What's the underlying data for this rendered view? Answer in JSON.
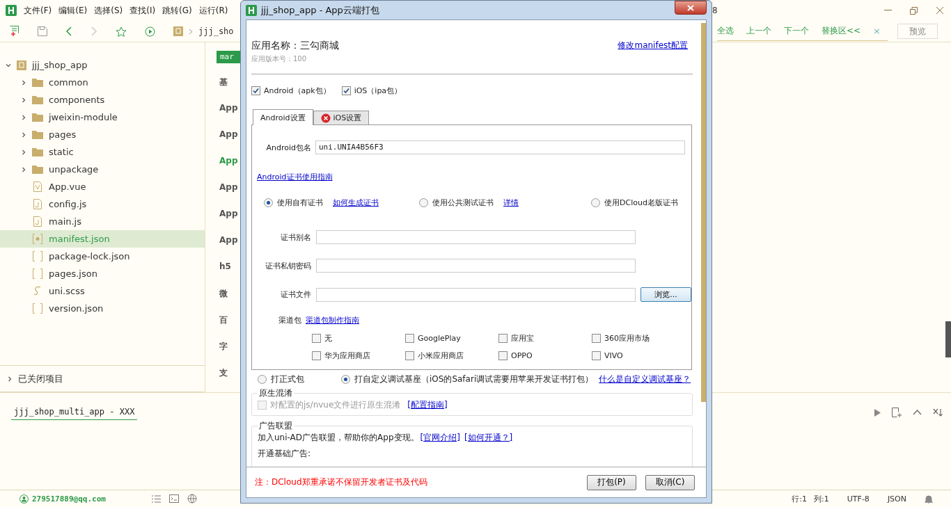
{
  "menu_bar": {
    "items": [
      "文件(F)",
      "编辑(E)",
      "选择(S)",
      "查找(I)",
      "跳转(G)",
      "运行(R)"
    ],
    "title_fragment": "8"
  },
  "toolbar": {
    "breadcrumb": "jjj_sho",
    "find_actions": [
      "全选",
      "上一个",
      "下一个",
      "替换区<<"
    ],
    "find_close": "×",
    "preview": "预览"
  },
  "sidebar": {
    "project": {
      "name": "jjj_shop_app",
      "expanded": true,
      "children": [
        {
          "name": "common",
          "kind": "folder",
          "expanded": false,
          "selected": false
        },
        {
          "name": "components",
          "kind": "folder",
          "expanded": false,
          "selected": false
        },
        {
          "name": "jweixin-module",
          "kind": "folder",
          "expanded": false,
          "selected": false
        },
        {
          "name": "pages",
          "kind": "folder",
          "expanded": false,
          "selected": false
        },
        {
          "name": "static",
          "kind": "folder",
          "expanded": false,
          "selected": false
        },
        {
          "name": "unpackage",
          "kind": "folder",
          "expanded": false,
          "selected": false
        },
        {
          "name": "App.vue",
          "kind": "vue",
          "selected": false
        },
        {
          "name": "config.js",
          "kind": "js",
          "selected": false
        },
        {
          "name": "main.js",
          "kind": "js",
          "selected": false
        },
        {
          "name": "manifest.json",
          "kind": "config",
          "selected": true
        },
        {
          "name": "package-lock.json",
          "kind": "json",
          "selected": false
        },
        {
          "name": "pages.json",
          "kind": "json",
          "selected": false
        },
        {
          "name": "uni.scss",
          "kind": "scss",
          "selected": false
        },
        {
          "name": "version.json",
          "kind": "json",
          "selected": false
        }
      ]
    },
    "closed_projects": {
      "label": "已关闭项目",
      "expanded": false
    }
  },
  "editor": {
    "tab": "mar",
    "outline": [
      {
        "label": "基",
        "selected": false
      },
      {
        "label": "App",
        "selected": false
      },
      {
        "label": "App",
        "selected": false
      },
      {
        "label": "App",
        "selected": true
      },
      {
        "label": "App",
        "selected": false
      },
      {
        "label": "App",
        "selected": false
      },
      {
        "label": "App",
        "selected": false
      },
      {
        "label": "h5",
        "selected": false
      },
      {
        "label": "微",
        "selected": false
      },
      {
        "label": "百",
        "selected": false
      },
      {
        "label": "字",
        "selected": false
      },
      {
        "label": "支",
        "selected": false
      }
    ]
  },
  "console": {
    "tab": "jjj_shop_multi_app - XXX"
  },
  "status_bar": {
    "user": "279517889@qq.com",
    "line": "行:1",
    "column": "列:1",
    "encoding": "UTF-8",
    "language": "JSON"
  },
  "dialog": {
    "title": "jjj_shop_app - App云端打包",
    "app_name": "应用名称：三勾商城",
    "version": "应用版本号：100",
    "manifest_link": "修改manifest配置",
    "platforms": [
      {
        "label": "Android（apk包）",
        "checked": true
      },
      {
        "label": "iOS（ipa包）",
        "checked": true
      }
    ],
    "tabs": [
      {
        "label": "Android设置",
        "selected": true,
        "error": false
      },
      {
        "label": "iOS设置",
        "selected": false,
        "error": true
      }
    ],
    "package_name": {
      "label": "Android包名",
      "value": "uni.UNIA4B56F3"
    },
    "cert_guide": "Android证书使用指南",
    "cert_options": [
      {
        "label": "使用自有证书",
        "link": "如何生成证书",
        "selected": true
      },
      {
        "label": "使用公共测试证书",
        "link": "详情",
        "selected": false
      },
      {
        "label": "使用DCloud老版证书",
        "selected": false
      }
    ],
    "cert_fields": [
      {
        "label": "证书别名"
      },
      {
        "label": "证书私钥密码"
      },
      {
        "label": "证书文件",
        "button": "浏览..."
      }
    ],
    "channels": {
      "label": "渠道包",
      "link": "渠道包制作指南",
      "items": [
        {
          "label": "无",
          "checked": false
        },
        {
          "label": "GooglePlay",
          "checked": false
        },
        {
          "label": "应用宝",
          "checked": false
        },
        {
          "label": "360应用市场",
          "checked": false
        },
        {
          "label": "华为应用商店",
          "checked": false
        },
        {
          "label": "小米应用商店",
          "checked": false
        },
        {
          "label": "OPPO",
          "checked": false
        },
        {
          "label": "VIVO",
          "checked": false
        }
      ]
    },
    "build_types": [
      {
        "label": "打正式包",
        "selected": false
      },
      {
        "label": "打自定义调试基座（iOS的Safari调试需要用苹果开发证书打包）",
        "selected": true
      }
    ],
    "build_help": "什么是自定义调试基座？",
    "obfuscation": {
      "title": "原生混淆",
      "option": {
        "label": "对配置的js/nvue文件进行原生混淆",
        "checked": false,
        "disabled": true
      },
      "link": "[配置指南]"
    },
    "ads": {
      "title": "广告联盟",
      "text": "加入uni-AD广告联盟，帮助你的App变现。",
      "links": [
        "[官网介绍]",
        "[如何开通？]"
      ],
      "subtitle": "开通基础广告:"
    },
    "note": "注：DCloud郑重承诺不保留开发者证书及代码",
    "buttons": [
      "打包(P)",
      "取消(C)"
    ]
  }
}
